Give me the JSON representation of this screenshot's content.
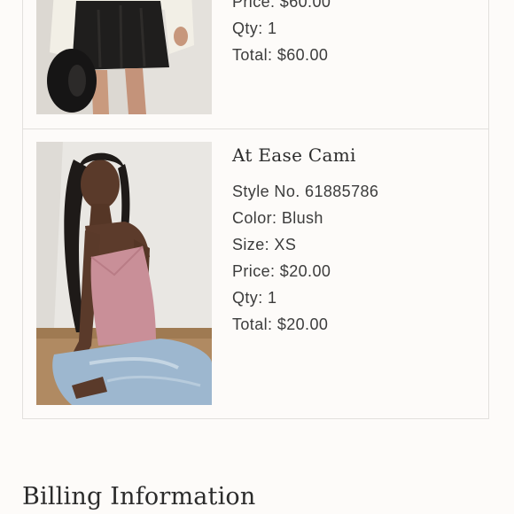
{
  "order_items": [
    {
      "price": "Price: $60.00",
      "qty": "Qty: 1",
      "total": "Total: $60.00"
    },
    {
      "name": "At Ease Cami",
      "style_no": "Style No. 61885786",
      "color": "Color: Blush",
      "size": "Size: XS",
      "price": "Price: $20.00",
      "qty": "Qty: 1",
      "total": "Total: $20.00"
    }
  ],
  "billing": {
    "heading": "Billing Information"
  },
  "colors": {
    "background": "#fdfbf9",
    "border": "#e2e0dd",
    "text": "#3c3c3c",
    "heading": "#2b2b2b"
  }
}
